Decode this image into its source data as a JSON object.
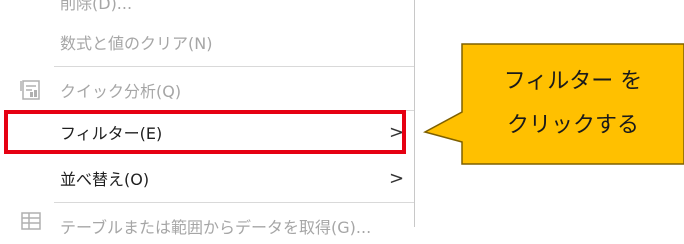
{
  "menu": {
    "items": [
      {
        "label": "削除(D)...",
        "disabled": true
      },
      {
        "label": "数式と値のクリア(N)",
        "disabled": true
      },
      {
        "label": "クイック分析(Q)",
        "disabled": true
      },
      {
        "label": "フィルター(E)",
        "disabled": false,
        "submenu": true
      },
      {
        "label": "並べ替え(O)",
        "disabled": false,
        "submenu": true
      },
      {
        "label": "テーブルまたは範囲からデータを取得(G)...",
        "disabled": true
      }
    ],
    "submenu_chevron": ">"
  },
  "callout": {
    "line1": "フィルター を",
    "line2": "クリックする",
    "fill_color": "#ffc000",
    "border_color": "#7f6000"
  },
  "highlight_color": "#e60012",
  "icons": {
    "quick_analysis": "quick-analysis-icon",
    "get_data": "table-range-icon"
  }
}
